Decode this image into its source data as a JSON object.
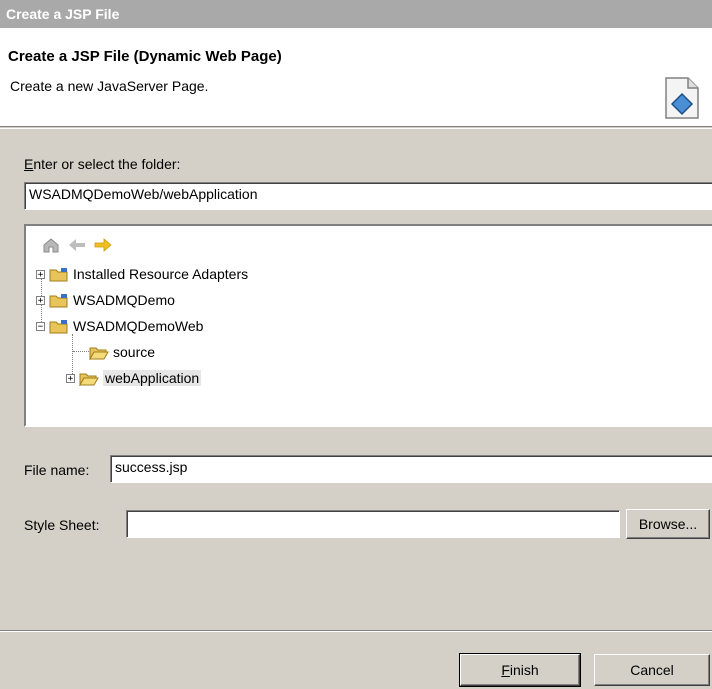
{
  "window": {
    "title": "Create a JSP File"
  },
  "banner": {
    "title": "Create a JSP File (Dynamic Web Page)",
    "description": "Create a new JavaServer Page."
  },
  "folder": {
    "label_mnemonic": "E",
    "label_rest": "nter or select the folder:",
    "value": "WSADMQDemoWeb/webApplication"
  },
  "tree": {
    "toolbar": [
      "home-icon",
      "back-arrow-icon",
      "forward-arrow-icon"
    ],
    "items": [
      {
        "label": "Installed Resource Adapters",
        "expander": "+"
      },
      {
        "label": "WSADMQDemo",
        "expander": "+"
      },
      {
        "label": "WSADMQDemoWeb",
        "expander": "−"
      },
      {
        "label": "source",
        "expander": ""
      },
      {
        "label": "webApplication",
        "expander": "+",
        "selected": true
      }
    ]
  },
  "file_name": {
    "label": "File name:",
    "value": "success.jsp"
  },
  "style_sheet": {
    "label": "Style Sheet:",
    "value": "",
    "browse_label": "Browse..."
  },
  "buttons": {
    "finish_mnemonic": "F",
    "finish_rest": "inish",
    "cancel": "Cancel"
  },
  "colors": {
    "title_bar": "#a9a9a9",
    "dialog": "#d4d0c8",
    "selection": "#e6e6e6"
  }
}
